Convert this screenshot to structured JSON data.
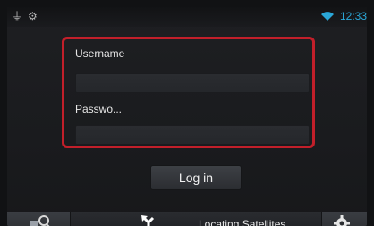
{
  "status_bar": {
    "usb_icon": "usb-icon",
    "bluetooth_icon": "bluetooth-icon",
    "wifi_icon": "wifi-icon",
    "time": "12:33",
    "time_color": "#2aa7d8"
  },
  "login": {
    "username_label": "Username",
    "username_value": "",
    "password_label": "Passwo...",
    "password_value": "",
    "login_button": "Log in",
    "highlight_color": "#c21f2a"
  },
  "bottom_bar": {
    "nav_icon": "map-search-icon",
    "turn_icon": "turn-arrow-icon",
    "status_text": "Locating Satellites",
    "settings_icon": "gear-icon"
  }
}
